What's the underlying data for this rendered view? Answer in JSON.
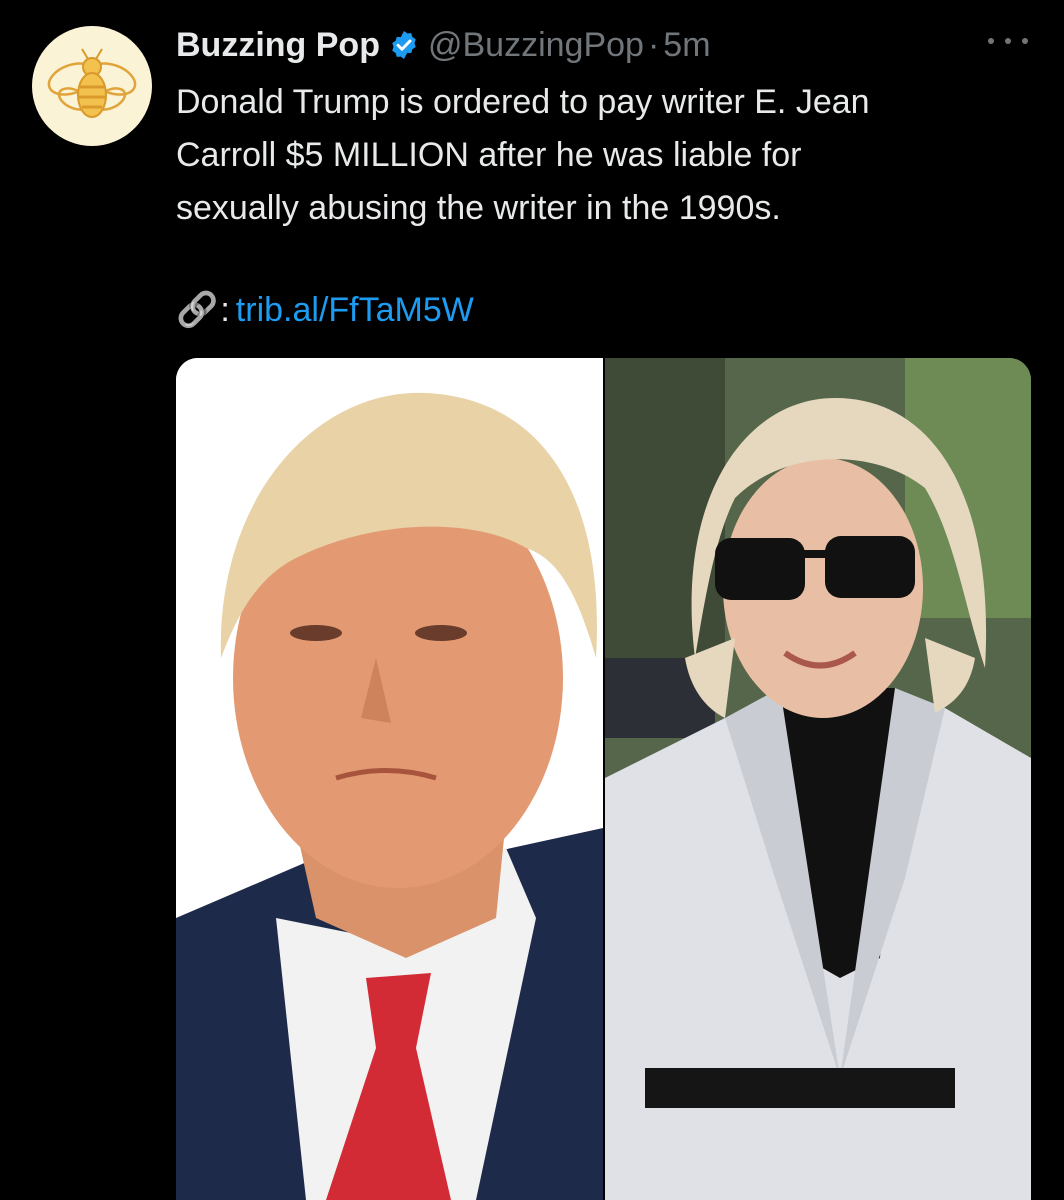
{
  "tweet": {
    "display_name": "Buzzing Pop",
    "handle": "@BuzzingPop",
    "separator": "·",
    "time": "5m",
    "text_line1": "Donald Trump is ordered to pay writer E. Jean",
    "text_line2": "Carroll $5 MILLION after he was liable for",
    "text_line3": "sexually abusing the writer in the 1990s.",
    "link_emoji": "🔗",
    "link_colon": ":",
    "link_url": "trib.al/FfTaM5W"
  },
  "icons": {
    "avatar": "bee-logo-icon",
    "verified": "verified-badge-icon",
    "more": "more-options-icon"
  },
  "colors": {
    "background": "#000000",
    "text": "#e7e9ea",
    "muted": "#71767b",
    "link": "#1d9bf0",
    "verified": "#1d9bf0",
    "avatar_bg": "#fbf3d5"
  }
}
